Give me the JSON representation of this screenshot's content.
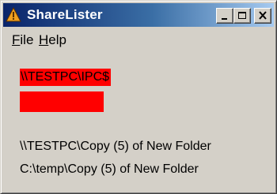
{
  "window": {
    "title": "ShareLister",
    "icon": "warning-cone-icon",
    "controls": [
      "minimize-icon",
      "maximize-icon",
      "close-icon"
    ]
  },
  "menu": {
    "file": "File",
    "help": "Help"
  },
  "content": {
    "share_label": "\\\\TESTPC\\IPC$",
    "network_path": "\\\\TESTPC\\Copy (5) of New Folder",
    "local_path": "C:\\temp\\Copy (5) of New Folder"
  },
  "colors": {
    "title_gradient_start": "#0a246a",
    "title_gradient_end": "#a6caf0",
    "window_face": "#d4d0c8",
    "highlight_red": "#ff0000"
  }
}
